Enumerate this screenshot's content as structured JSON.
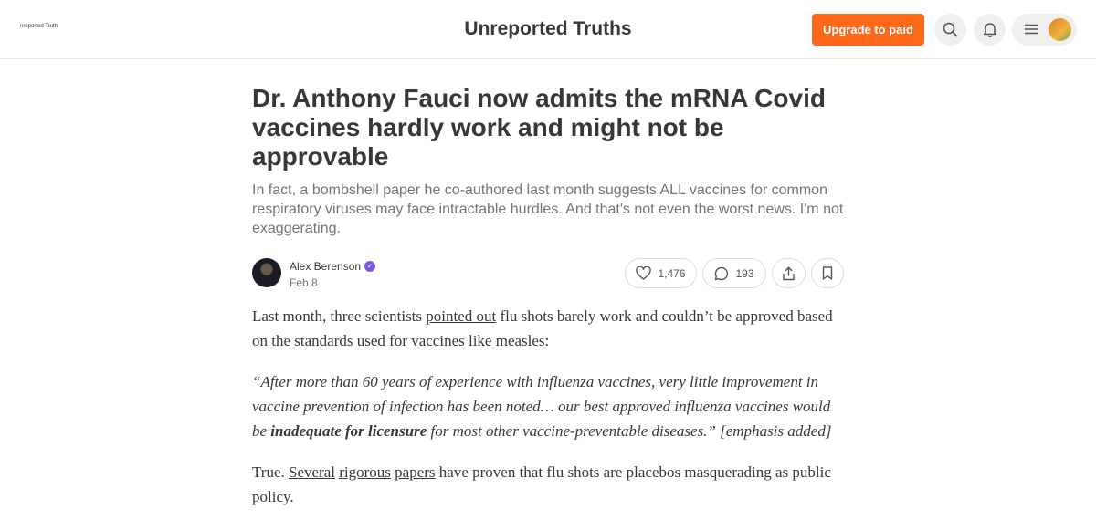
{
  "header": {
    "logo_text": "nreported Truth",
    "publication_title": "Unreported Truths",
    "upgrade_label": "Upgrade to paid",
    "icons": [
      "search-icon",
      "bell-icon",
      "menu-icon"
    ],
    "accent_color": "#ff6719"
  },
  "article": {
    "title": "Dr. Anthony Fauci now admits the mRNA Covid vaccines hardly work and might not be approvable",
    "subtitle": "In fact, a bombshell paper he co-authored last month suggests ALL vaccines for common respiratory viruses may face intractable hurdles. And that's not even the worst news. I'm not exaggerating.",
    "author": "Alex Berenson",
    "date": "Feb 8",
    "likes": "1,476",
    "comments": "193"
  },
  "body": {
    "p1_a": "Last month, three scientists ",
    "p1_link": "pointed out",
    "p1_b": " flu shots barely work and couldn’t be approved based on the standards used for vaccines like measles:",
    "quote_a": "“After more than 60 years of experience with influenza vaccines, very little improvement in vaccine prevention of infection has been noted… our best approved influenza vaccines would be ",
    "quote_bold": "inadequate for licensure",
    "quote_b": " for most other vaccine-preventable diseases.” [emphasis added]",
    "p2_a": "True. ",
    "p2_link1": "Several",
    "p2_link2": "rigorous",
    "p2_link3": "papers",
    "p2_b": " have proven that flu shots are placebos masquerading as public policy."
  }
}
